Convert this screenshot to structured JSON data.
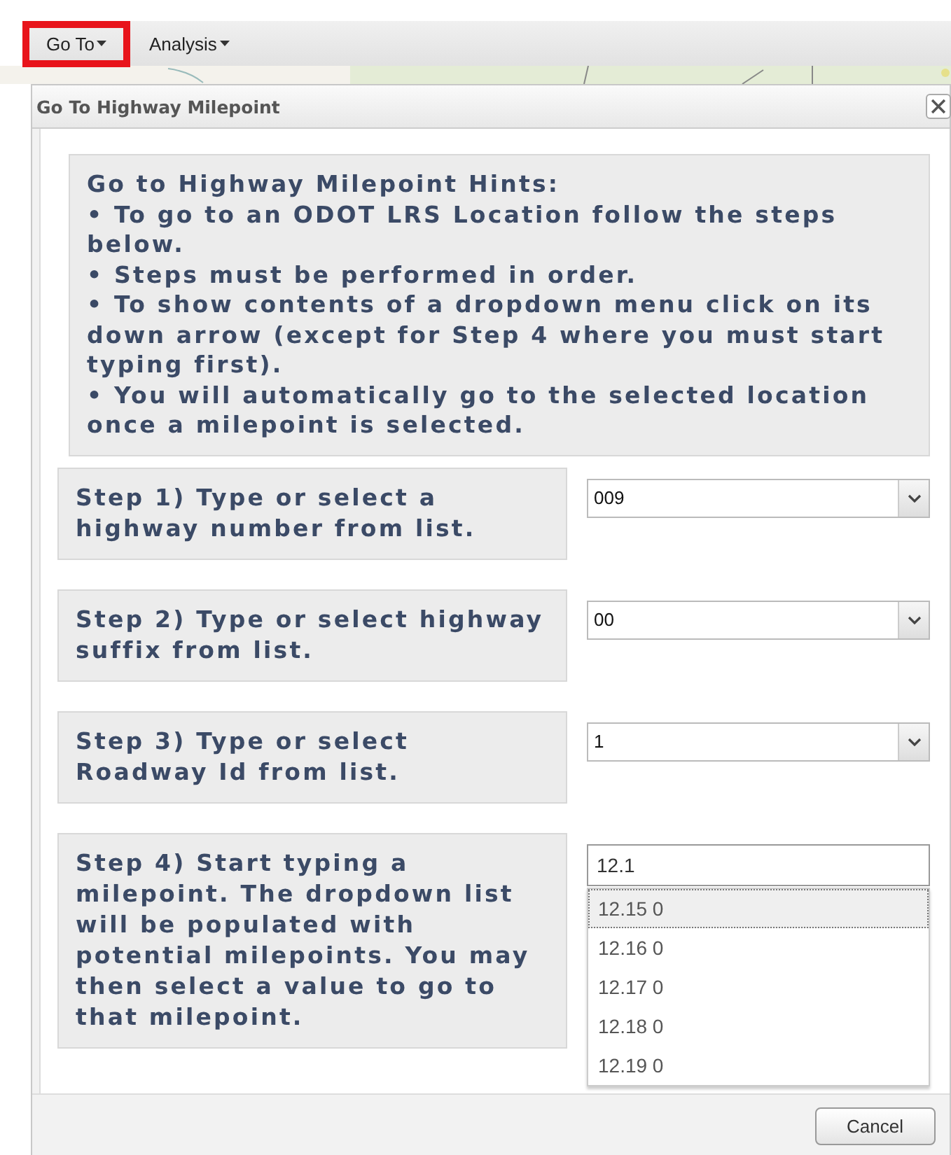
{
  "toolbar": {
    "menus": [
      {
        "label": "Go To",
        "highlighted": true
      },
      {
        "label": "Analysis",
        "highlighted": false
      }
    ]
  },
  "dialog": {
    "title": "Go To Highway Milepoint",
    "hints": {
      "title": "Go to Highway Milepoint Hints:",
      "items": [
        "• To go to an ODOT LRS Location follow the steps below.",
        "• Steps must be performed in order.",
        "• To show contents of a dropdown menu click on its down arrow (except for Step 4 where you must start typing first).",
        "• You will automatically go to the selected location once a milepoint is selected."
      ]
    },
    "steps": [
      {
        "kind": "select",
        "label": "Step 1) Type or select a highway number from list.",
        "value": "009"
      },
      {
        "kind": "select",
        "label": "Step 2) Type or select highway suffix from list.",
        "value": "00"
      },
      {
        "kind": "select",
        "label": "Step 3) Type or select Roadway Id from list.",
        "value": "1"
      },
      {
        "kind": "autocomplete",
        "label": "Step 4) Start typing a milepoint. The dropdown list will be populated with potential milepoints. You may then select a value to go to that milepoint.",
        "value": "12.1",
        "options": [
          {
            "label": "12.15 0",
            "selected": true
          },
          {
            "label": "12.16 0",
            "selected": false
          },
          {
            "label": "12.17 0",
            "selected": false
          },
          {
            "label": "12.18 0",
            "selected": false
          },
          {
            "label": "12.19 0",
            "selected": false
          }
        ]
      }
    ],
    "buttons": [
      "Cancel"
    ]
  }
}
